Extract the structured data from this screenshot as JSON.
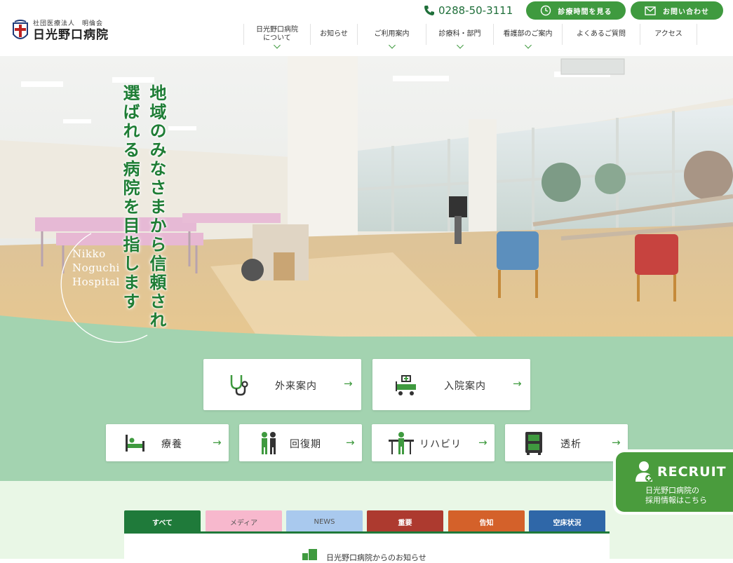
{
  "brand": {
    "corp": "社団医療法人　明倫会",
    "name": "日光野口病院"
  },
  "header": {
    "phone": "0288-50-3111",
    "hours_button": "診療時間を見る",
    "contact_button": "お問い合わせ"
  },
  "nav": {
    "items": [
      {
        "label": "日光野口病院",
        "label2": "について",
        "has_dropdown": true
      },
      {
        "label": "お知らせ",
        "has_dropdown": false
      },
      {
        "label": "ご利用案内",
        "has_dropdown": true
      },
      {
        "label": "診療科・部門",
        "has_dropdown": true
      },
      {
        "label": "看護部のご案内",
        "has_dropdown": true
      },
      {
        "label": "よくあるご質問",
        "has_dropdown": false
      },
      {
        "label": "アクセス",
        "has_dropdown": false
      }
    ]
  },
  "hero": {
    "copy_line1": "地域のみなさまから信頼され、",
    "copy_line2": "選ばれる病院を目指します",
    "english_line1": "Nikko",
    "english_line2": "Noguchi",
    "english_line3": "Hospital"
  },
  "services": {
    "large": [
      {
        "label": "外来案内",
        "icon": "stethoscope-icon"
      },
      {
        "label": "入院案内",
        "icon": "hospital-bed-icon"
      }
    ],
    "small": [
      {
        "label": "療養",
        "icon": "patient-bed-icon"
      },
      {
        "label": "回復期",
        "icon": "recovery-walk-icon"
      },
      {
        "label": "リハビリ",
        "icon": "rehab-bars-icon"
      },
      {
        "label": "透析",
        "icon": "dialysis-machine-icon"
      }
    ]
  },
  "news_tabs": [
    {
      "label": "すべて",
      "color": "#1f7a3a"
    },
    {
      "label": "メディア",
      "color": "#f7b8cd"
    },
    {
      "label": "NEWS",
      "color": "#a9c9ee"
    },
    {
      "label": "重要",
      "color": "#ad3a2f"
    },
    {
      "label": "告知",
      "color": "#d4612a"
    },
    {
      "label": "空床状況",
      "color": "#2f67a8"
    }
  ],
  "news": {
    "heading": "日光野口病院からのお知らせ"
  },
  "recruit": {
    "title": "RECRUIT",
    "sub_line1": "日光野口病院の",
    "sub_line2": "採用情報はこちら"
  },
  "colors": {
    "brand_green": "#3f9a3f",
    "band_green": "#a3d3b0",
    "text_green": "#1e7d35"
  }
}
